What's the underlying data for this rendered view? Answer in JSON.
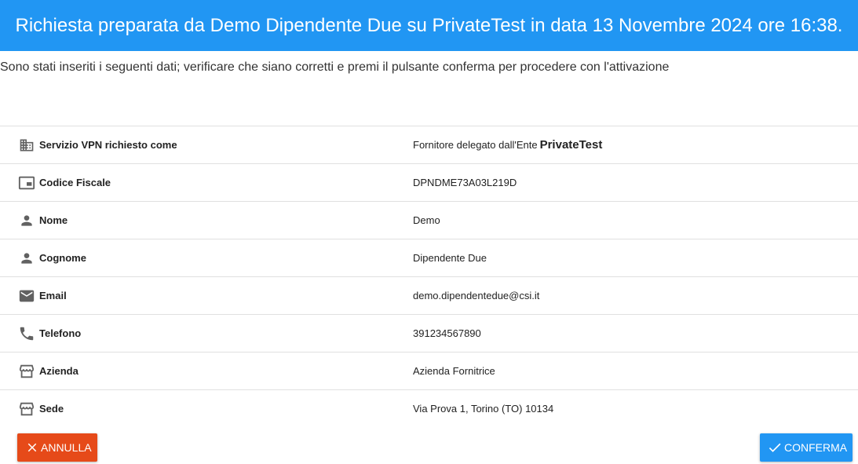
{
  "header": {
    "title": "Richiesta preparata da Demo Dipendente Due su PrivateTest in data 13 Novembre 2024 ore 16:38."
  },
  "intro": {
    "text": "Sono stati inseriti i seguenti dati; verificare che siano corretti e premi il pulsante conferma per procedere con l'attivazione"
  },
  "rows": [
    {
      "label": "Servizio VPN richiesto come",
      "value": "Fornitore delegato dall'Ente",
      "value_strong": "PrivateTest",
      "icon": "building-icon"
    },
    {
      "label": "Codice Fiscale",
      "value": "DPNDME73A03L219D",
      "icon": "id-card-icon"
    },
    {
      "label": "Nome",
      "value": "Demo",
      "icon": "person-icon"
    },
    {
      "label": "Cognome",
      "value": "Dipendente Due",
      "icon": "person-icon"
    },
    {
      "label": "Email",
      "value": "demo.dipendentedue@csi.it",
      "icon": "mail-icon"
    },
    {
      "label": "Telefono",
      "value": "391234567890",
      "icon": "phone-icon"
    },
    {
      "label": "Azienda",
      "value": "Azienda Fornitrice",
      "icon": "store-icon"
    },
    {
      "label": "Sede",
      "value": "Via Prova 1, Torino (TO) 10134",
      "icon": "store-icon"
    }
  ],
  "buttons": {
    "annulla_label": "ANNULLA",
    "conferma_label": "CONFERMA"
  },
  "colors": {
    "header_bg": "#2196f3",
    "annulla_bg": "#e64a19",
    "conferma_bg": "#2196f3"
  }
}
